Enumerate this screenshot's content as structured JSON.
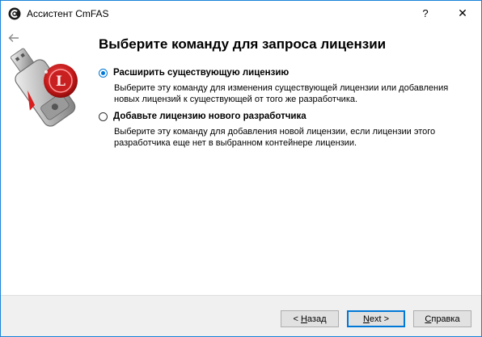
{
  "window": {
    "title": "Ассистент CmFAS",
    "help_glyph": "?",
    "close_glyph": "✕",
    "accent_color": "#0078d7"
  },
  "page": {
    "heading": "Выберите команду для запроса лицензии"
  },
  "options": [
    {
      "label": "Расширить существующую лицензию",
      "description": "Выберите эту команду для изменения существующей лицензии или добавления новых лицензий к существующей от того же разработчика.",
      "selected": true
    },
    {
      "label": "Добавьте лицензию нового разработчика",
      "description": "Выберите эту команду для добавления новой лицензии, если лицензии этого разработчика еще нет в выбранном контейнере лицензии.",
      "selected": false
    }
  ],
  "buttons": {
    "back": {
      "prefix": "< ",
      "mnemonic": "Н",
      "rest": "азад"
    },
    "next": {
      "mnemonic": "N",
      "rest": "ext >"
    },
    "help": {
      "mnemonic": "С",
      "rest": "правка"
    }
  },
  "icons": {
    "app": "codemeter-icon",
    "back": "back-arrow-icon",
    "logo": "usb-dongle-license-seal-icon"
  }
}
